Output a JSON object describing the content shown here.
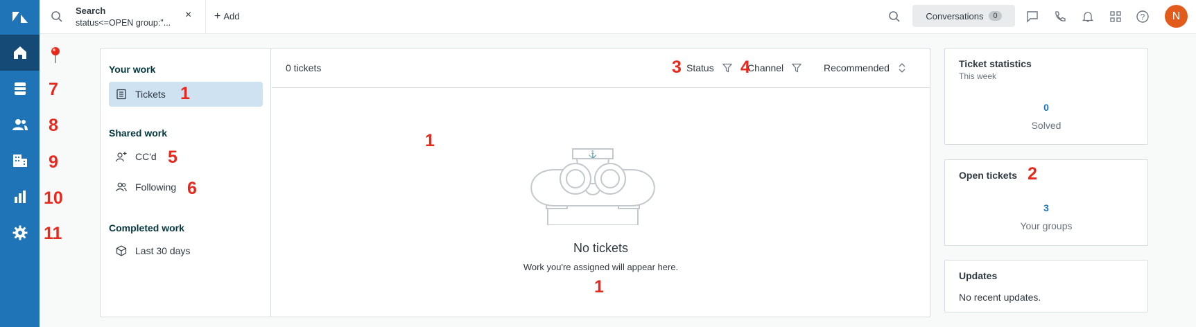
{
  "topbar": {
    "search_tab_title": "Search",
    "search_tab_query": "status<=OPEN group:\"...",
    "add_label": "Add",
    "conversations_label": "Conversations",
    "conversations_count": "0",
    "avatar_initial": "N"
  },
  "views": {
    "your_work_heading": "Your work",
    "tickets_label": "Tickets",
    "shared_work_heading": "Shared work",
    "ccd_label": "CC'd",
    "following_label": "Following",
    "completed_work_heading": "Completed work",
    "last30_label": "Last 30 days"
  },
  "list": {
    "count_text": "0 tickets",
    "status_filter": "Status",
    "channel_filter": "Channel",
    "sort_label": "Recommended",
    "empty_title": "No tickets",
    "empty_subtitle": "Work you're assigned will appear here."
  },
  "cards": {
    "stats_title": "Ticket statistics",
    "stats_sub": "This week",
    "solved_value": "0",
    "solved_label": "Solved",
    "open_title": "Open tickets",
    "open_value": "3",
    "open_label": "Your groups",
    "updates_title": "Updates",
    "updates_text": "No recent updates."
  },
  "annotations": {
    "a_tickets": "1",
    "a_list": "1",
    "a_empty": "1",
    "a_open": "2",
    "a_status": "3",
    "a_channel": "4",
    "a_ccd": "5",
    "a_following": "6",
    "a_nav_views": "7",
    "a_nav_customers": "8",
    "a_nav_orgs": "9",
    "a_nav_reporting": "10",
    "a_nav_admin": "11"
  },
  "colors": {
    "nav_bg": "#1f73b7",
    "nav_active": "#144a75",
    "selected_view": "#cee2f2",
    "annotation": "#e8281d",
    "avatar": "#e35b1b",
    "stat_value": "#1f73b7"
  },
  "icons": [
    "zendesk-logo",
    "home-icon",
    "views-icon",
    "customers-icon",
    "organizations-icon",
    "reporting-icon",
    "admin-gear-icon",
    "search-icon",
    "close-icon",
    "chat-icon",
    "phone-icon",
    "bell-icon",
    "apps-grid-icon",
    "help-icon",
    "pin-icon",
    "ticket-list-icon",
    "person-add-icon",
    "people-icon",
    "cube-icon",
    "filter-icon",
    "sort-icon"
  ]
}
